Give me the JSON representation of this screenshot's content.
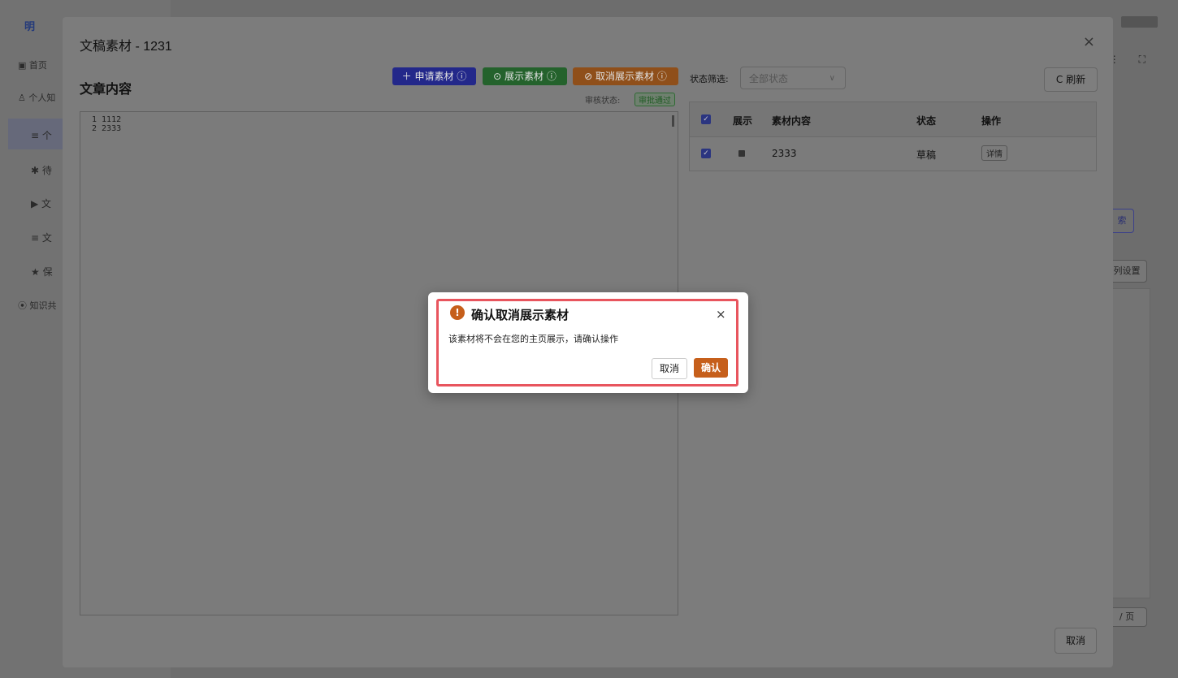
{
  "app": {
    "logo_text": "明",
    "nav": [
      {
        "label": "首页"
      },
      {
        "label": "个人知"
      },
      {
        "label": "个"
      },
      {
        "label": "待"
      },
      {
        "label": "文"
      },
      {
        "label": "文"
      },
      {
        "label": "保"
      },
      {
        "label": "知识共"
      }
    ],
    "search_button": "索",
    "column_settings": "列设置",
    "pager": "/ 页"
  },
  "drawer": {
    "title": "文稿素材 - 1231",
    "close_icon": "×",
    "section_title": "文章内容",
    "buttons": {
      "apply": "＋ 申请素材 ⓘ",
      "show": "⊙ 展示素材 ⓘ",
      "hide": "⊘ 取消展示素材 ⓘ"
    },
    "audit_label": "审核状态:",
    "audit_status": "审批通过",
    "editor_lines": [
      "1 1112",
      "2 2333"
    ],
    "filter": {
      "label": "状态筛选:",
      "placeholder": "全部状态",
      "chevron": "∨"
    },
    "refresh": "C 刷新",
    "table": {
      "headers": [
        "展示",
        "素材内容",
        "状态",
        "操作"
      ],
      "rows": [
        {
          "content": "2333",
          "status": "草稿",
          "action": "详情"
        }
      ]
    },
    "footer_cancel": "取消"
  },
  "confirm": {
    "icon": "!",
    "title": "确认取消展示素材",
    "close_icon": "×",
    "message": "该素材将不会在您的主页展示，请确认操作",
    "cancel": "取消",
    "ok": "确认"
  },
  "colors": {
    "primary": "#2f3bd9",
    "success": "#36a046",
    "warning": "#d86f26",
    "highlight_border": "#e8555e"
  }
}
